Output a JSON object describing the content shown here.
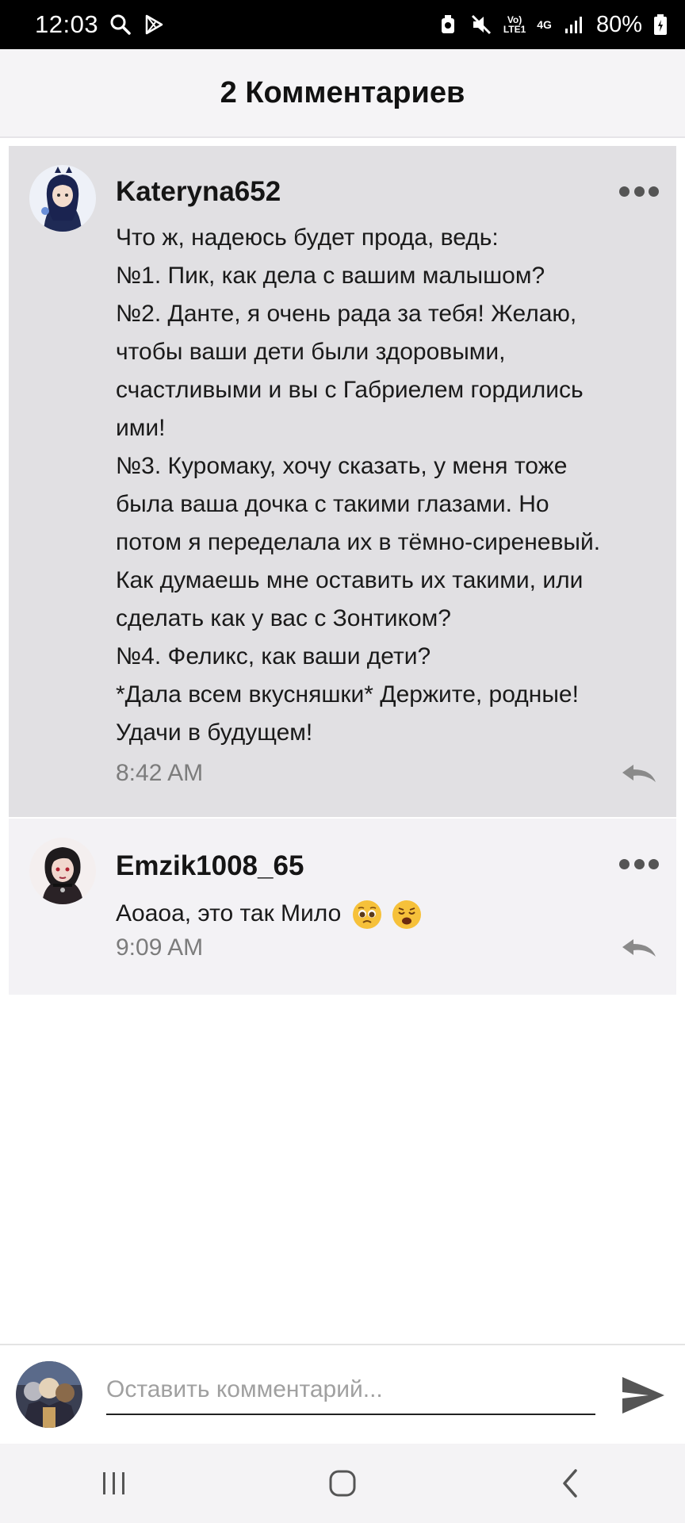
{
  "status_bar": {
    "time": "12:03",
    "network_top": "Vo)",
    "network_bottom": "LTE1",
    "network_type": "4G",
    "battery": "80%",
    "icons": [
      "search-icon",
      "play-store-icon",
      "alarm-icon",
      "mute-icon",
      "signal-icon",
      "battery-icon"
    ]
  },
  "header": {
    "title": "2 Комментариев"
  },
  "comments": [
    {
      "username": "Kateryna652",
      "lines": [
        "Что ж, надеюсь будет прода, ведь:",
        "№1. Пик, как дела с вашим малышом?",
        "№2. Данте, я очень рада за тебя! Желаю,",
        "чтобы ваши дети были здоровыми,",
        "счастливыми и вы с Габриелем гордились",
        "ими!",
        "№3. Куромаку, хочу сказать, у меня тоже",
        "была ваша дочка с такими глазами. Но",
        "потом я переделала их в тёмно-сиреневый.",
        "Как думаешь мне оставить их такими, или",
        "сделать как у вас с Зонтиком?",
        "№4. Феликс, как ваши дети?",
        "*Дала всем вкусняшки* Держите, родные!",
        "Удачи в будущем!"
      ],
      "time": "8:42 AM"
    },
    {
      "username": "Emzik1008_65",
      "text": "Аоаоа, это так Мило",
      "emojis": [
        "pleading-face-emoji",
        "weary-face-emoji"
      ],
      "time": "9:09 AM"
    }
  ],
  "input": {
    "placeholder": "Оставить комментарий..."
  },
  "nav": {
    "icons": [
      "recents-icon",
      "home-icon",
      "back-icon"
    ]
  },
  "colors": {
    "highlight_bg": "#e1e0e3",
    "comment_bg": "#f3f2f5",
    "header_bg": "#f5f4f6",
    "timestamp": "#7c7c7c"
  }
}
